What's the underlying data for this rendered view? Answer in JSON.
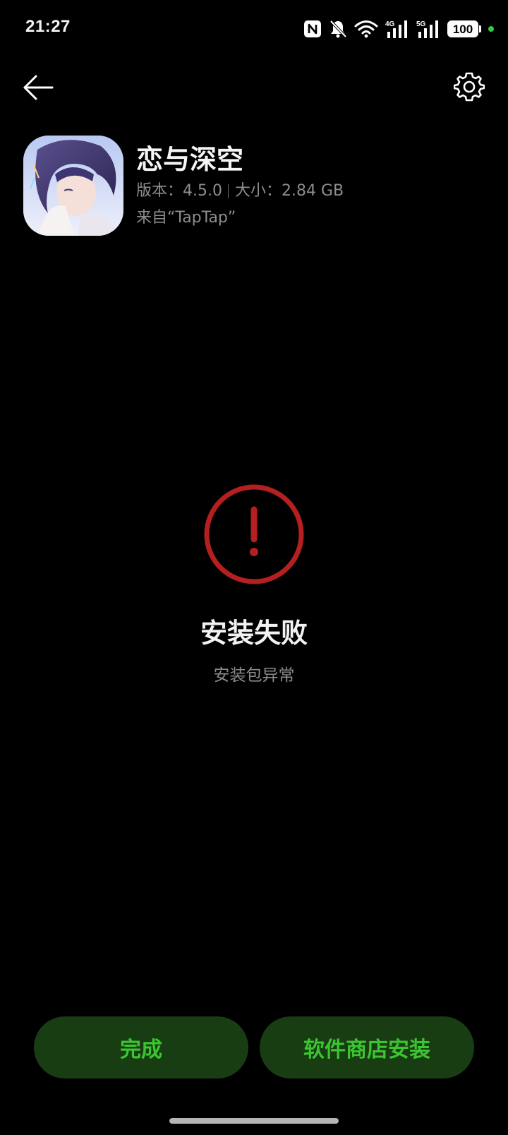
{
  "status_bar": {
    "time": "21:27",
    "battery": "100",
    "icons": [
      "nfc-icon",
      "bell-off-icon",
      "wifi-icon",
      "signal-4g-icon",
      "signal-5g-icon",
      "battery-icon"
    ],
    "network_4g": "4G",
    "network_5g": "5G",
    "privacy_dot_color": "#2ecc40"
  },
  "toolbar": {
    "back_icon": "arrow-left-icon",
    "settings_icon": "gear-icon"
  },
  "app": {
    "name": "恋与深空",
    "version_label": "版本：4.5.0",
    "size_label": "大小：2.84 GB",
    "source": "来自“TapTap”"
  },
  "result": {
    "icon": "exclamation-circle-icon",
    "icon_color": "#b3201f",
    "title": "安装失败",
    "subtitle": "安装包异常"
  },
  "actions": {
    "done_label": "完成",
    "store_install_label": "软件商店安装",
    "button_bg": "#183d13",
    "button_text_color": "#3cc532"
  }
}
